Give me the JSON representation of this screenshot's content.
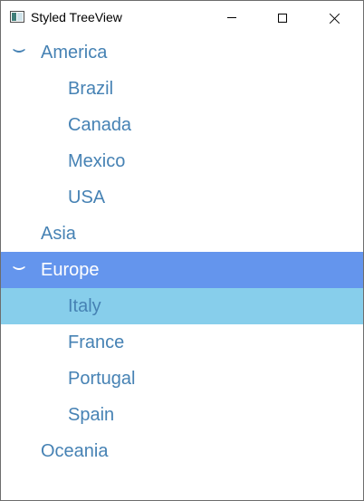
{
  "window": {
    "title": "Styled TreeView",
    "icon": "app-window-icon",
    "controls": [
      "minimize-icon",
      "maximize-icon",
      "close-icon"
    ]
  },
  "colors": {
    "text": "#4682b4",
    "selected_bg": "#6495ed",
    "selected_text": "#ffffff",
    "hover_bg": "#87ceeb"
  },
  "tree": {
    "america": {
      "label": "America",
      "expanded": true
    },
    "america_children": [
      "Brazil",
      "Canada",
      "Mexico",
      "USA"
    ],
    "asia": {
      "label": "Asia"
    },
    "europe": {
      "label": "Europe",
      "expanded": true,
      "selected": true
    },
    "europe_children": [
      "Italy",
      "France",
      "Portugal",
      "Spain"
    ],
    "europe_hovered_child": "Italy",
    "oceania": {
      "label": "Oceania"
    }
  }
}
